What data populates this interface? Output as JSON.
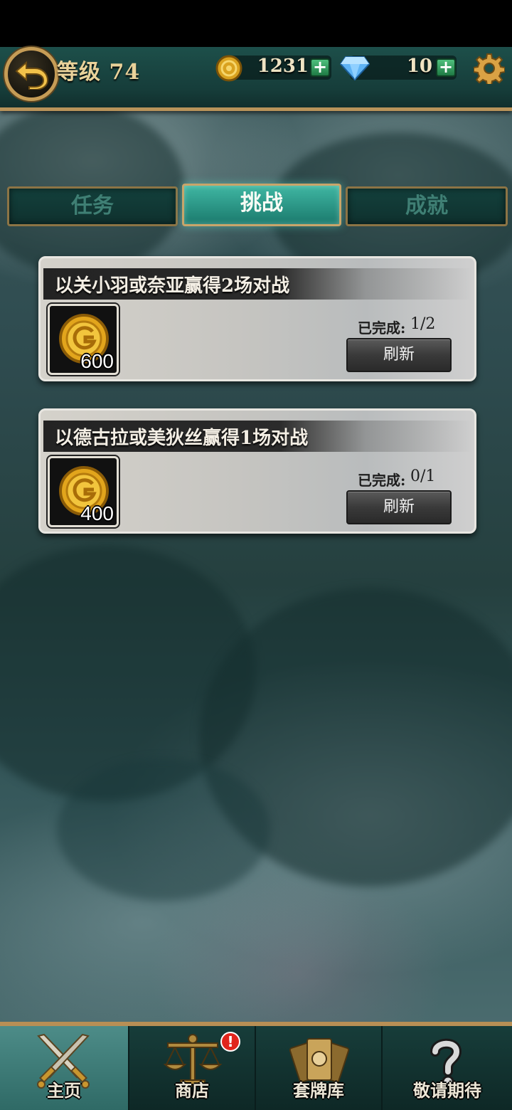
{
  "header": {
    "level_label": "等级 74",
    "coins": "1231",
    "gems": "10",
    "plus": "+"
  },
  "tabs": [
    {
      "label": "任务",
      "active": false
    },
    {
      "label": "挑战",
      "active": true
    },
    {
      "label": "成就",
      "active": false
    }
  ],
  "challenges": [
    {
      "title": "以关小羽或奈亚赢得2场对战",
      "reward": "600",
      "progress_label": "已完成:",
      "progress": "1/2",
      "refresh_label": "刷新"
    },
    {
      "title": "以德古拉或美狄丝赢得1场对战",
      "reward": "400",
      "progress_label": "已完成:",
      "progress": "0/1",
      "refresh_label": "刷新"
    }
  ],
  "nav": [
    {
      "label": "主页",
      "icon": "crossed-swords-icon",
      "active": true
    },
    {
      "label": "商店",
      "icon": "scales-icon",
      "active": false,
      "badge": "!"
    },
    {
      "label": "套牌库",
      "icon": "card-deck-icon",
      "active": false
    },
    {
      "label": "敬请期待",
      "icon": "question-mark-icon",
      "active": false
    }
  ],
  "colors": {
    "gold_border": "#b9935a",
    "teal_active": "#3fb6a2",
    "badge_red": "#e0251c"
  }
}
